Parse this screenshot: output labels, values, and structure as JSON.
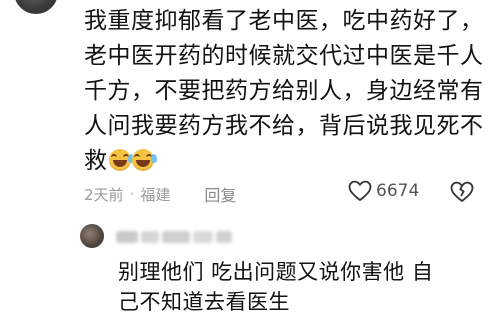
{
  "comment": {
    "lines": [
      "我重度抑郁看了老中医，吃中药好了，",
      "老中医开药的时候就交代过中医是千人",
      "千方，不要把药方给别人，身边经常有",
      "人问我要药方我不给，背后说我见死不",
      "救"
    ],
    "emojis": [
      "grinning-sweat-emoji",
      "grinning-sweat-emoji"
    ],
    "time": "2天前",
    "separator": "·",
    "location": "福建",
    "reply_label": "回复",
    "like_count": "6674"
  },
  "reply": {
    "lines": [
      "别理他们 吃出问题又说你害他 自",
      "己不知道去看医生"
    ]
  },
  "colors": {
    "text": "#121212",
    "meta": "#9a9a9a",
    "emoji": "#f6c443"
  }
}
